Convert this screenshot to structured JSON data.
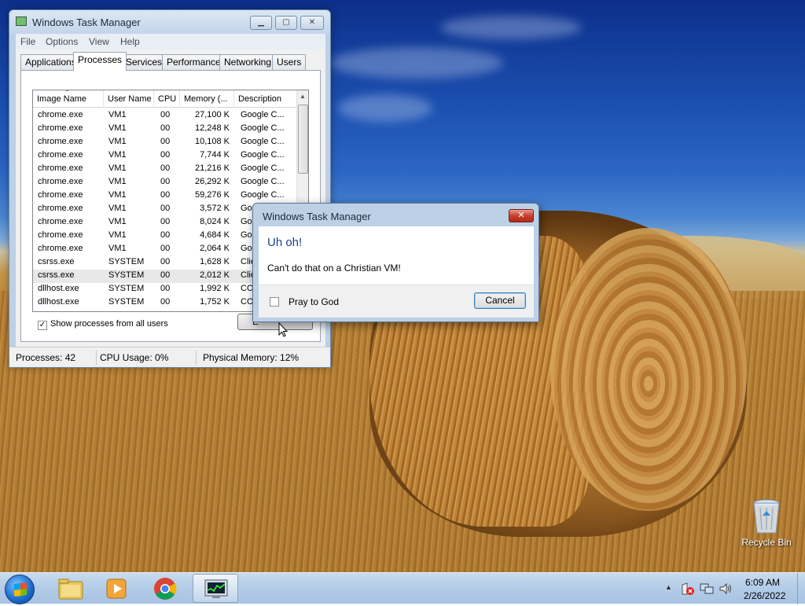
{
  "desktop": {
    "recycle_bin_label": "Recycle Bin"
  },
  "task_manager": {
    "title": "Windows Task Manager",
    "window_buttons": [
      "minimize",
      "maximize",
      "close"
    ],
    "menu": [
      "File",
      "Options",
      "View",
      "Help"
    ],
    "tabs": [
      {
        "label": "Applications",
        "active": false
      },
      {
        "label": "Processes",
        "active": true
      },
      {
        "label": "Services",
        "active": false
      },
      {
        "label": "Performance",
        "active": false
      },
      {
        "label": "Networking",
        "active": false
      },
      {
        "label": "Users",
        "active": false
      }
    ],
    "columns": [
      "Image Name",
      "User Name",
      "CPU",
      "Memory (...",
      "Description"
    ],
    "rows": [
      {
        "image": "chrome.exe",
        "user": "VM1",
        "cpu": "00",
        "mem": "27,100 K",
        "desc": "Google C..."
      },
      {
        "image": "chrome.exe",
        "user": "VM1",
        "cpu": "00",
        "mem": "12,248 K",
        "desc": "Google C..."
      },
      {
        "image": "chrome.exe",
        "user": "VM1",
        "cpu": "00",
        "mem": "10,108 K",
        "desc": "Google C..."
      },
      {
        "image": "chrome.exe",
        "user": "VM1",
        "cpu": "00",
        "mem": "7,744 K",
        "desc": "Google C..."
      },
      {
        "image": "chrome.exe",
        "user": "VM1",
        "cpu": "00",
        "mem": "21,216 K",
        "desc": "Google C..."
      },
      {
        "image": "chrome.exe",
        "user": "VM1",
        "cpu": "00",
        "mem": "26,292 K",
        "desc": "Google C..."
      },
      {
        "image": "chrome.exe",
        "user": "VM1",
        "cpu": "00",
        "mem": "59,276 K",
        "desc": "Google C..."
      },
      {
        "image": "chrome.exe",
        "user": "VM1",
        "cpu": "00",
        "mem": "3,572 K",
        "desc": "Google C..."
      },
      {
        "image": "chrome.exe",
        "user": "VM1",
        "cpu": "00",
        "mem": "8,024 K",
        "desc": "Goo"
      },
      {
        "image": "chrome.exe",
        "user": "VM1",
        "cpu": "00",
        "mem": "4,684 K",
        "desc": "Goo"
      },
      {
        "image": "chrome.exe",
        "user": "VM1",
        "cpu": "00",
        "mem": "2,064 K",
        "desc": "Goo"
      },
      {
        "image": "csrss.exe",
        "user": "SYSTEM",
        "cpu": "00",
        "mem": "1,628 K",
        "desc": "Clie"
      },
      {
        "image": "csrss.exe",
        "user": "SYSTEM",
        "cpu": "00",
        "mem": "2,012 K",
        "desc": "Clie",
        "selected": true
      },
      {
        "image": "dllhost.exe",
        "user": "SYSTEM",
        "cpu": "00",
        "mem": "1,992 K",
        "desc": "CO"
      },
      {
        "image": "dllhost.exe",
        "user": "SYSTEM",
        "cpu": "00",
        "mem": "1,752 K",
        "desc": "CO"
      }
    ],
    "show_all_label": "Show processes from all users",
    "show_all_checked": true,
    "end_process_label": "E",
    "status": {
      "processes": "Processes: 42",
      "cpu": "CPU Usage: 0%",
      "memory": "Physical Memory: 12%"
    }
  },
  "dialog": {
    "title": "Windows Task Manager",
    "close_glyph": "✕",
    "heading": "Uh oh!",
    "message": "Can't do that on a Christian VM!",
    "checkbox_label": "Pray to God",
    "checkbox_checked": false,
    "cancel_label": "Cancel"
  },
  "taskbar": {
    "clock_time": "6:09 AM",
    "clock_date": "2/26/2022",
    "tray_up_arrow": "▲"
  }
}
